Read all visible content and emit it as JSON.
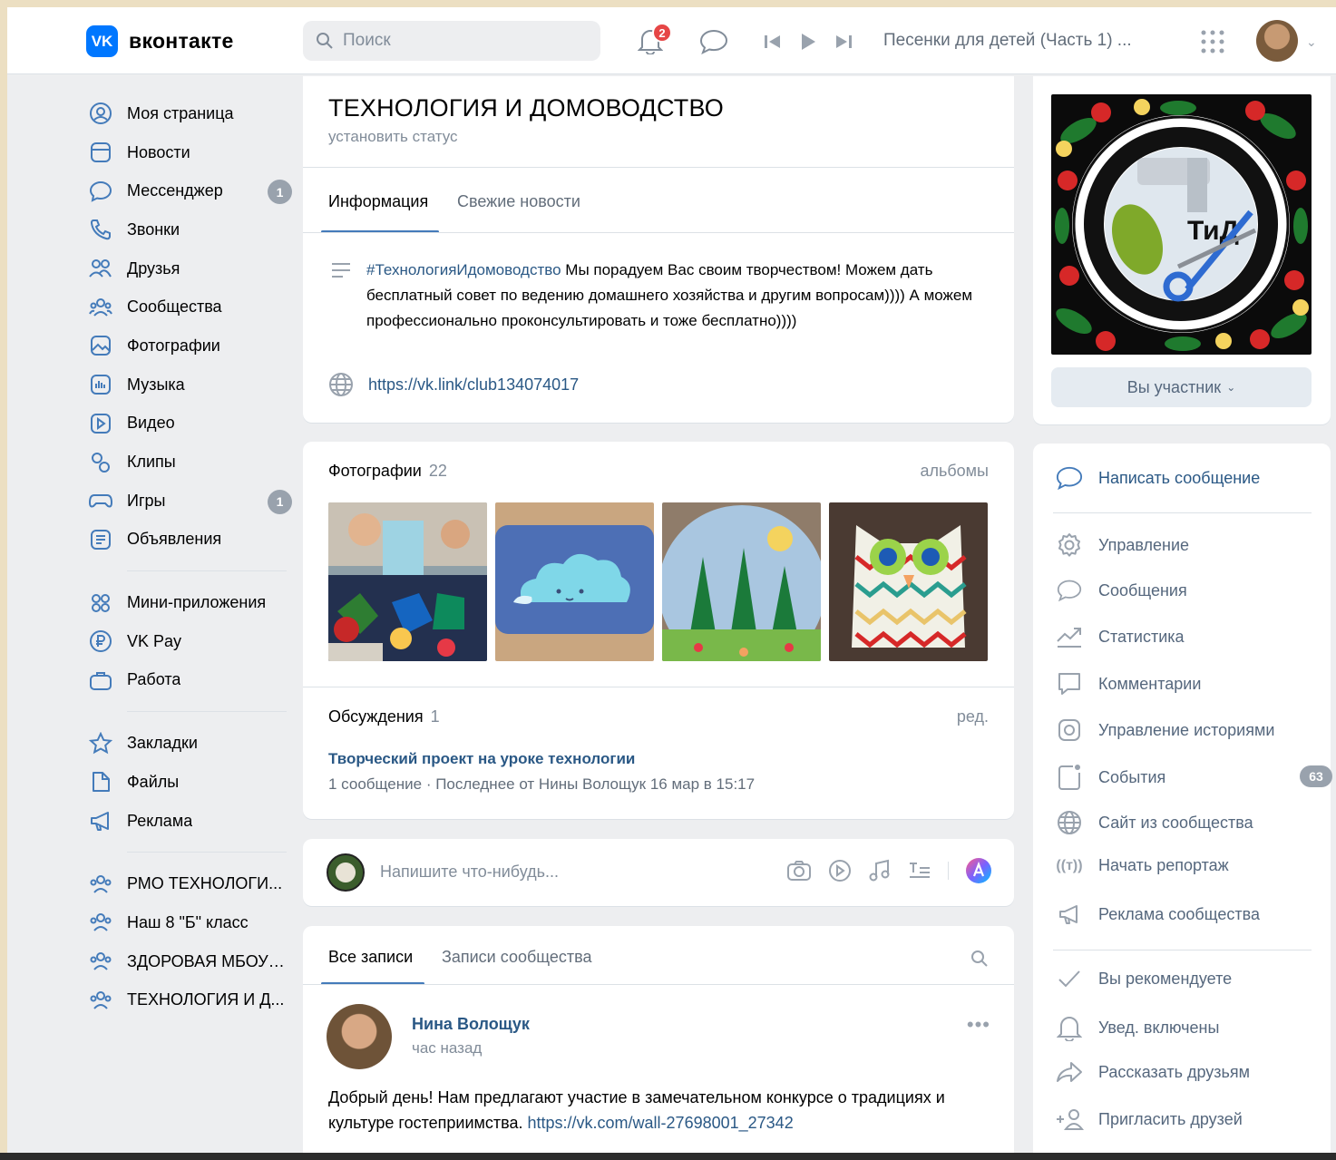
{
  "header": {
    "logo_badge": "VK",
    "logo_text": "вконтакте",
    "search_placeholder": "Поиск",
    "notifications_count": "2",
    "now_playing": "Песенки для детей (Часть 1) ..."
  },
  "sidebar": {
    "main": [
      {
        "label": "Моя страница",
        "icon": "profile-icon"
      },
      {
        "label": "Новости",
        "icon": "news-icon"
      },
      {
        "label": "Мессенджер",
        "icon": "messenger-icon",
        "count": "1"
      },
      {
        "label": "Звонки",
        "icon": "phone-icon"
      },
      {
        "label": "Друзья",
        "icon": "friends-icon"
      },
      {
        "label": "Сообщества",
        "icon": "communities-icon"
      },
      {
        "label": "Фотографии",
        "icon": "photos-icon"
      },
      {
        "label": "Музыка",
        "icon": "music-icon"
      },
      {
        "label": "Видео",
        "icon": "video-icon"
      },
      {
        "label": "Клипы",
        "icon": "clips-icon"
      },
      {
        "label": "Игры",
        "icon": "games-icon",
        "count": "1"
      },
      {
        "label": "Объявления",
        "icon": "classifieds-icon"
      }
    ],
    "services": [
      {
        "label": "Мини-приложения",
        "icon": "mini-apps-icon"
      },
      {
        "label": "VK Pay",
        "icon": "vkpay-icon"
      },
      {
        "label": "Работа",
        "icon": "work-icon"
      }
    ],
    "tools": [
      {
        "label": "Закладки",
        "icon": "bookmark-icon"
      },
      {
        "label": "Файлы",
        "icon": "files-icon"
      },
      {
        "label": "Реклама",
        "icon": "ads-icon"
      }
    ],
    "groups": [
      {
        "label": "РМО ТЕХНОЛОГИ..."
      },
      {
        "label": "Наш 8 \"Б\" класс"
      },
      {
        "label": "ЗДОРОВАЯ МБОУ ..."
      },
      {
        "label": "ТЕХНОЛОГИЯ И Д..."
      }
    ]
  },
  "group": {
    "title": "ТЕХНОЛОГИЯ И ДОМОВОДСТВО",
    "status": "установить статус",
    "tabs": [
      "Информация",
      "Свежие новости"
    ],
    "description_hashtag": "#ТехнологияИдомоводство",
    "description": " Мы порадуем Вас своим творчеством! Можем дать бесплатный совет по ведению домашнего хозяйства и другим вопросам)))) А можем профессионально проконсультировать и тоже бесплатно))))",
    "link": "https://vk.link/club134074017"
  },
  "photos": {
    "title": "Фотографии",
    "count": "22",
    "albums_link": "альбомы"
  },
  "discussions": {
    "title": "Обсуждения",
    "count": "1",
    "edit_link": "ред.",
    "topic_title": "Творческий проект на уроке технологии",
    "topic_meta": "1 сообщение  ·  Последнее от Нины Волощук 16 мар в 15:17"
  },
  "composer": {
    "placeholder": "Напишите что-нибудь..."
  },
  "wall": {
    "tabs": [
      "Все записи",
      "Записи сообщества"
    ],
    "post": {
      "author": "Нина Волощук",
      "time": "час назад",
      "text": "Добрый день! Нам предлагают участие в замечательном конкурсе о традициях и культуре гостеприимства. ",
      "link": "https://vk.com/wall-27698001_27342"
    }
  },
  "right": {
    "cover_text": "ТиД",
    "member_button": "Вы участник",
    "write_message": "Написать сообщение",
    "admin": [
      {
        "label": "Управление",
        "icon": "gear-icon"
      },
      {
        "label": "Сообщения",
        "icon": "message-icon"
      },
      {
        "label": "Статистика",
        "icon": "stats-icon"
      },
      {
        "label": "Комментарии",
        "icon": "comments-icon"
      },
      {
        "label": "Управление историями",
        "icon": "stories-icon"
      },
      {
        "label": "События",
        "icon": "events-icon",
        "count": "63"
      },
      {
        "label": "Сайт из сообщества",
        "icon": "globe-icon"
      },
      {
        "label": "Начать репортаж",
        "icon": "broadcast-icon"
      },
      {
        "label": "Реклама сообщества",
        "icon": "megaphone-icon"
      }
    ],
    "social": [
      {
        "label": "Вы рекомендуете",
        "icon": "check-icon"
      },
      {
        "label": "Увед. включены",
        "icon": "bell-icon"
      },
      {
        "label": "Рассказать друзьям",
        "icon": "share-icon"
      },
      {
        "label": "Пригласить друзей",
        "icon": "invite-icon"
      }
    ]
  },
  "colors": {
    "accent": "#2a5885",
    "brand": "#0077ff",
    "badge": "#99a2ad",
    "alert": "#e64646"
  }
}
